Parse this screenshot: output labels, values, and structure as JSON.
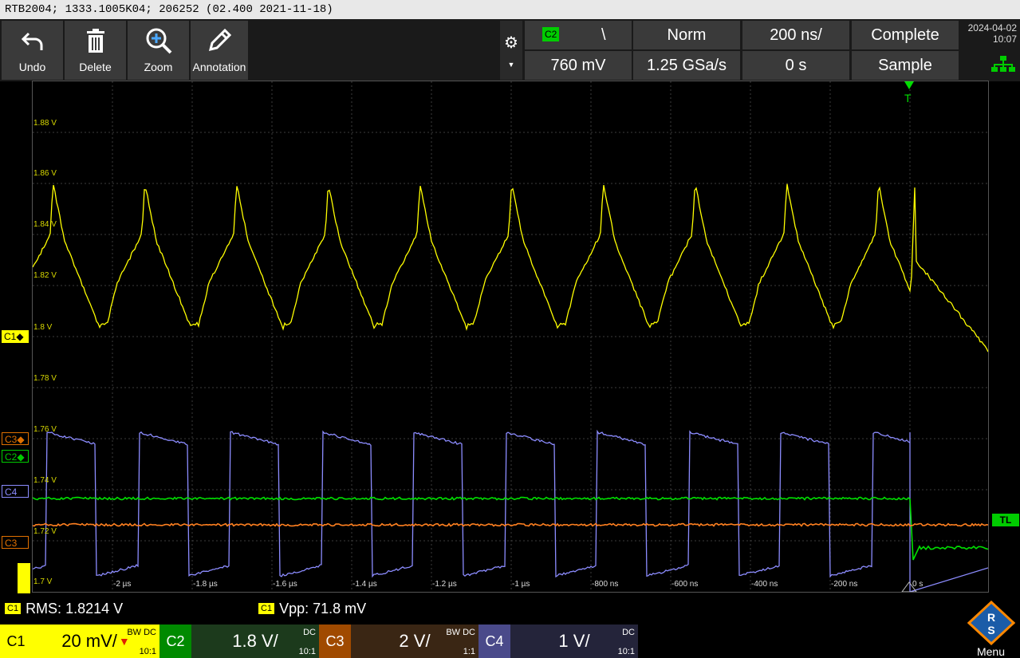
{
  "title": "RTB2004; 1333.1005K04; 206252 (02.400 2021-11-18)",
  "toolbar": {
    "undo": "Undo",
    "delete": "Delete",
    "zoom": "Zoom",
    "annotation": "Annotation"
  },
  "trigger": {
    "source": "C2",
    "slope_symbol": "\\",
    "mode": "Norm",
    "level": "760 mV",
    "timebase": "200 ns/",
    "sample_rate": "1.25 GSa/s",
    "position": "0 s",
    "acq_status": "Complete",
    "acq_mode": "Sample"
  },
  "datetime": {
    "date": "2024-04-02",
    "time": "10:07"
  },
  "y_labels": [
    "1.88 V",
    "1.86 V",
    "1.84 V",
    "1.82 V",
    "1.8 V",
    "1.78 V",
    "1.76 V",
    "1.74 V",
    "1.72 V",
    "1.7 V"
  ],
  "x_labels": [
    "-2 µs",
    "-1.8 µs",
    "-1.6 µs",
    "-1.4 µs",
    "-1.2 µs",
    "-1 µs",
    "-800 ns",
    "-600 ns",
    "-400 ns",
    "-200 ns",
    "0 s"
  ],
  "channel_markers": {
    "c1": "C1",
    "c3": "C3",
    "c2": "C2",
    "c4": "C4",
    "c3b": "C3",
    "tl": "TL"
  },
  "measurements": {
    "m1_tag": "C1",
    "m1_text": "RMS: 1.8214 V",
    "m2_tag": "C1",
    "m2_text": "Vpp: 71.8 mV"
  },
  "channels": [
    {
      "name": "C1",
      "scale": "20 mV/",
      "coupling": "DC",
      "bw": "BW",
      "probe": "10:1",
      "color": "#ffff00"
    },
    {
      "name": "C2",
      "scale": "1.8 V/",
      "coupling": "DC",
      "bw": "",
      "probe": "10:1",
      "color": "#00aa00"
    },
    {
      "name": "C3",
      "scale": "2 V/",
      "coupling": "DC",
      "bw": "BW",
      "probe": "1:1",
      "color": "#e07000"
    },
    {
      "name": "C4",
      "scale": "1 V/",
      "coupling": "DC",
      "bw": "",
      "probe": "10:1",
      "color": "#8080ff"
    }
  ],
  "menu_label": "Menu",
  "colors": {
    "c1": "#ffff00",
    "c2": "#00e000",
    "c3": "#ff8020",
    "c4": "#8c8cff",
    "grid": "#3c3c3c"
  }
}
